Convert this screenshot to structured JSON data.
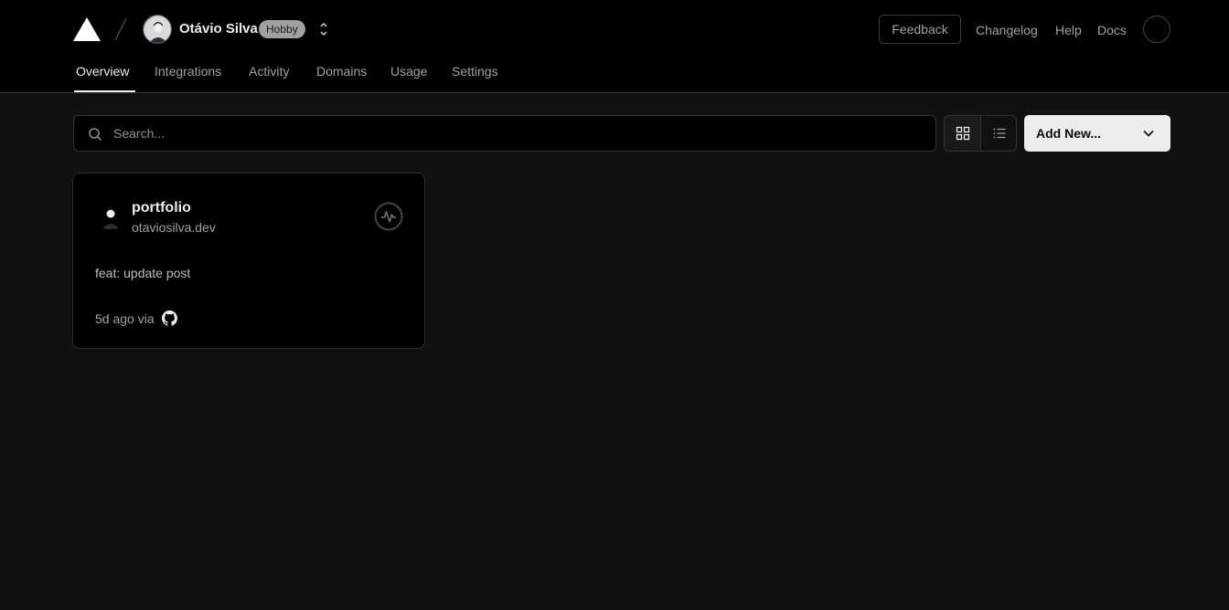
{
  "header": {
    "team_name": "Otávio Silva",
    "plan_badge": "Hobby",
    "feedback_label": "Feedback",
    "links": [
      "Changelog",
      "Help",
      "Docs"
    ]
  },
  "tabs": [
    {
      "label": "Overview",
      "active": true
    },
    {
      "label": "Integrations",
      "active": false
    },
    {
      "label": "Activity",
      "active": false
    },
    {
      "label": "Domains",
      "active": false
    },
    {
      "label": "Usage",
      "active": false
    },
    {
      "label": "Settings",
      "active": false
    }
  ],
  "toolbar": {
    "search_placeholder": "Search...",
    "add_new_label": "Add New..."
  },
  "projects": [
    {
      "name": "portfolio",
      "domain": "otaviosilva.dev",
      "commit_message": "feat: update post",
      "commit_meta": "5d ago via",
      "source_icon": "github-icon"
    }
  ],
  "colors": {
    "background": "#111111",
    "header_background": "#000000",
    "primary_button": "#ededed",
    "badge": "#a1a1a1"
  }
}
